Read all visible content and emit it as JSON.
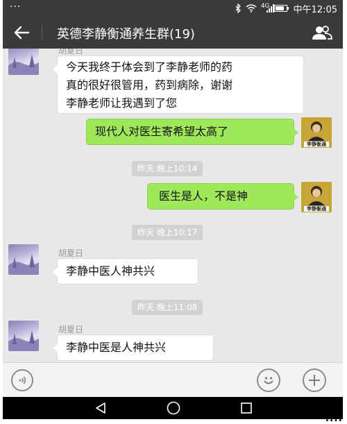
{
  "status_bar": {
    "dots": "···",
    "signal_label": "4G",
    "carrier_time": "中午12:05"
  },
  "header": {
    "title": "英德李静衡通养生群(19)"
  },
  "messages": [
    {
      "type": "text",
      "side": "left",
      "sender": "胡夏日",
      "lines": [
        "今天我终于体会到了李静老师的药",
        "真的很好很管用，药到病除，谢谢",
        "李静老师让我遇到了您"
      ]
    },
    {
      "type": "text",
      "side": "right",
      "text": "现代人对医生寄希望太高了"
    },
    {
      "type": "time",
      "text": "昨天 晚上10:14"
    },
    {
      "type": "text",
      "side": "right",
      "text": "医生是人，不是神"
    },
    {
      "type": "time",
      "text": "昨天 晚上10:17"
    },
    {
      "type": "text",
      "side": "left",
      "sender": "胡夏日",
      "text": "李静中医人神共兴"
    },
    {
      "type": "time",
      "text": "昨天 晚上11:08"
    },
    {
      "type": "text",
      "side": "left",
      "sender": "胡夏日",
      "text": "李静中医是人神共兴"
    }
  ],
  "avatar_self": {
    "label": "李静衡通"
  },
  "corner_mark": "....",
  "colors": {
    "bar_dark": "#3a3a3a",
    "chat_bg": "#e8e8e8",
    "bubble_green": "#9ee85a",
    "bubble_white": "#ffffff",
    "time_chip": "#d2d2d2"
  },
  "icons": {
    "back": "arrow-left-icon",
    "group_info": "group-people-icon",
    "voice": "voice-icon",
    "emoji": "smiley-icon",
    "more": "plus-icon",
    "nav_back": "triangle-back-icon",
    "nav_home": "circle-home-icon",
    "nav_recent": "square-recent-icon"
  }
}
